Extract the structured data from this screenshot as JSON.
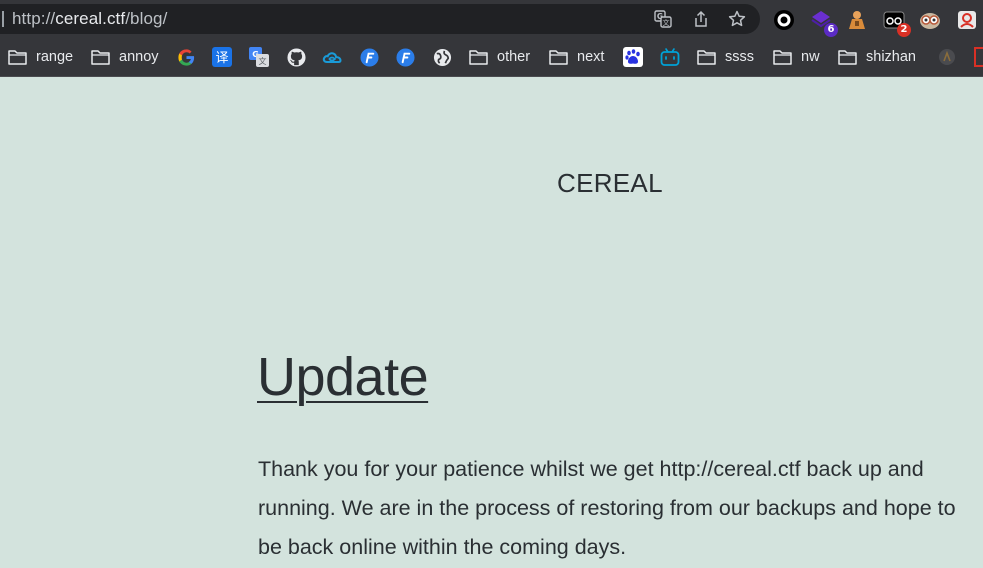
{
  "browser": {
    "url_scheme": "http://",
    "url_host": "cereal.ctf",
    "url_path": "/blog/",
    "extension_badges": {
      "extension_2": "6",
      "extension_4": "2"
    }
  },
  "bookmarks": {
    "items": [
      {
        "type": "folder",
        "label": "range"
      },
      {
        "type": "folder",
        "label": "annoy"
      },
      {
        "type": "icon",
        "icon": "google-icon"
      },
      {
        "type": "icon",
        "icon": "translate-icon",
        "glyph": "译"
      },
      {
        "type": "icon",
        "icon": "google-translate-icon"
      },
      {
        "type": "icon",
        "icon": "github-icon"
      },
      {
        "type": "icon",
        "icon": "cloud-icon"
      },
      {
        "type": "icon",
        "icon": "blue-f-icon-1"
      },
      {
        "type": "icon",
        "icon": "blue-f-icon-2"
      },
      {
        "type": "icon",
        "icon": "globe-icon"
      },
      {
        "type": "folder",
        "label": "other"
      },
      {
        "type": "folder",
        "label": "next"
      },
      {
        "type": "icon",
        "icon": "baidu-paw-icon"
      },
      {
        "type": "icon",
        "icon": "bilibili-icon"
      },
      {
        "type": "folder",
        "label": "ssss"
      },
      {
        "type": "folder",
        "label": "nw"
      },
      {
        "type": "folder",
        "label": "shizhan"
      }
    ]
  },
  "page": {
    "site_title": "CEREAL",
    "post_title": "Update",
    "post_body": "Thank you for your patience whilst we get http://cereal.ctf back up and running. We are in the process of restoring from our backups and hope to be back online within the coming days."
  },
  "colors": {
    "page_background": "#d3e3dd",
    "chrome_dark": "#35363a",
    "omnibox": "#202124",
    "text_dark": "#2a2f33"
  }
}
